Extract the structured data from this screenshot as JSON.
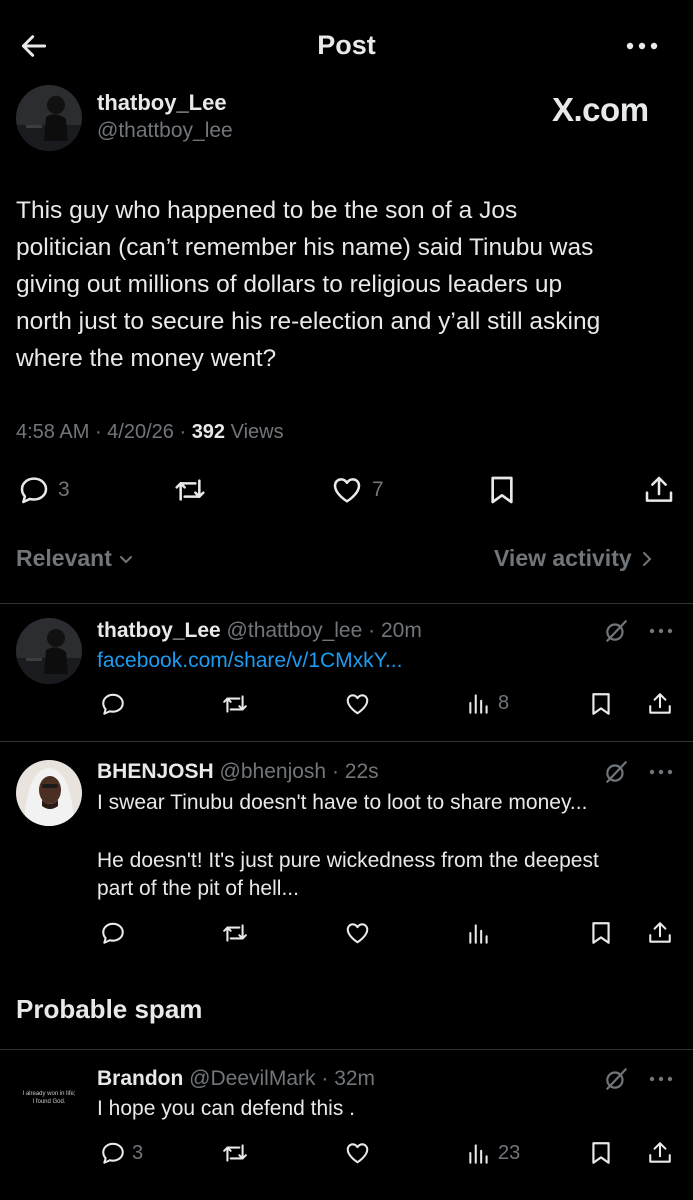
{
  "header": {
    "title": "Post",
    "back_icon": "arrow-left-icon",
    "more_icon": "more-horizontal-icon"
  },
  "main_post": {
    "display_name": "thatboy_Lee",
    "handle": "@thattboy_lee",
    "watermark": "X.com",
    "text_lines": [
      "This guy who happened to be the son of a Jos",
      "politician (can’t remember his name) said Tinubu was",
      "giving out millions of dollars to religious leaders up",
      "north just to secure his re-election and y’all still asking",
      "where the money went?"
    ],
    "time": "4:58 AM",
    "date": "4/20/26",
    "views_count": "392",
    "views_label": "Views",
    "reply_count": "3",
    "like_count": "7"
  },
  "sort_bar": {
    "relevant_label": "Relevant",
    "view_activity_label": "View activity"
  },
  "replies": [
    {
      "display_name": "thatboy_Lee",
      "handle": "@thattboy_lee",
      "time": "20m",
      "link": "facebook.com/share/v/1CMxkY...",
      "views": "8"
    },
    {
      "display_name": "BHENJOSH",
      "handle": "@bhenjosh",
      "time": "22s",
      "line1": "I swear Tinubu doesn't have to loot to share money...",
      "line2": "He doesn't! It's just pure wickedness from the deepest",
      "line3": "part of the pit of hell..."
    }
  ],
  "spam_section": {
    "title": "Probable spam",
    "reply": {
      "display_name": "Brandon",
      "handle": "@DeevilMark",
      "time": "32m",
      "text": "I hope you can defend this .",
      "avatar_text_1": "I already won in life;",
      "avatar_text_2": "I found God.",
      "reply_count": "3",
      "views": "23"
    }
  },
  "colors": {
    "background": "#000000",
    "text": "#e7e9ea",
    "muted": "#71767b",
    "link": "#1d9bf0",
    "divider": "#2f3336"
  }
}
